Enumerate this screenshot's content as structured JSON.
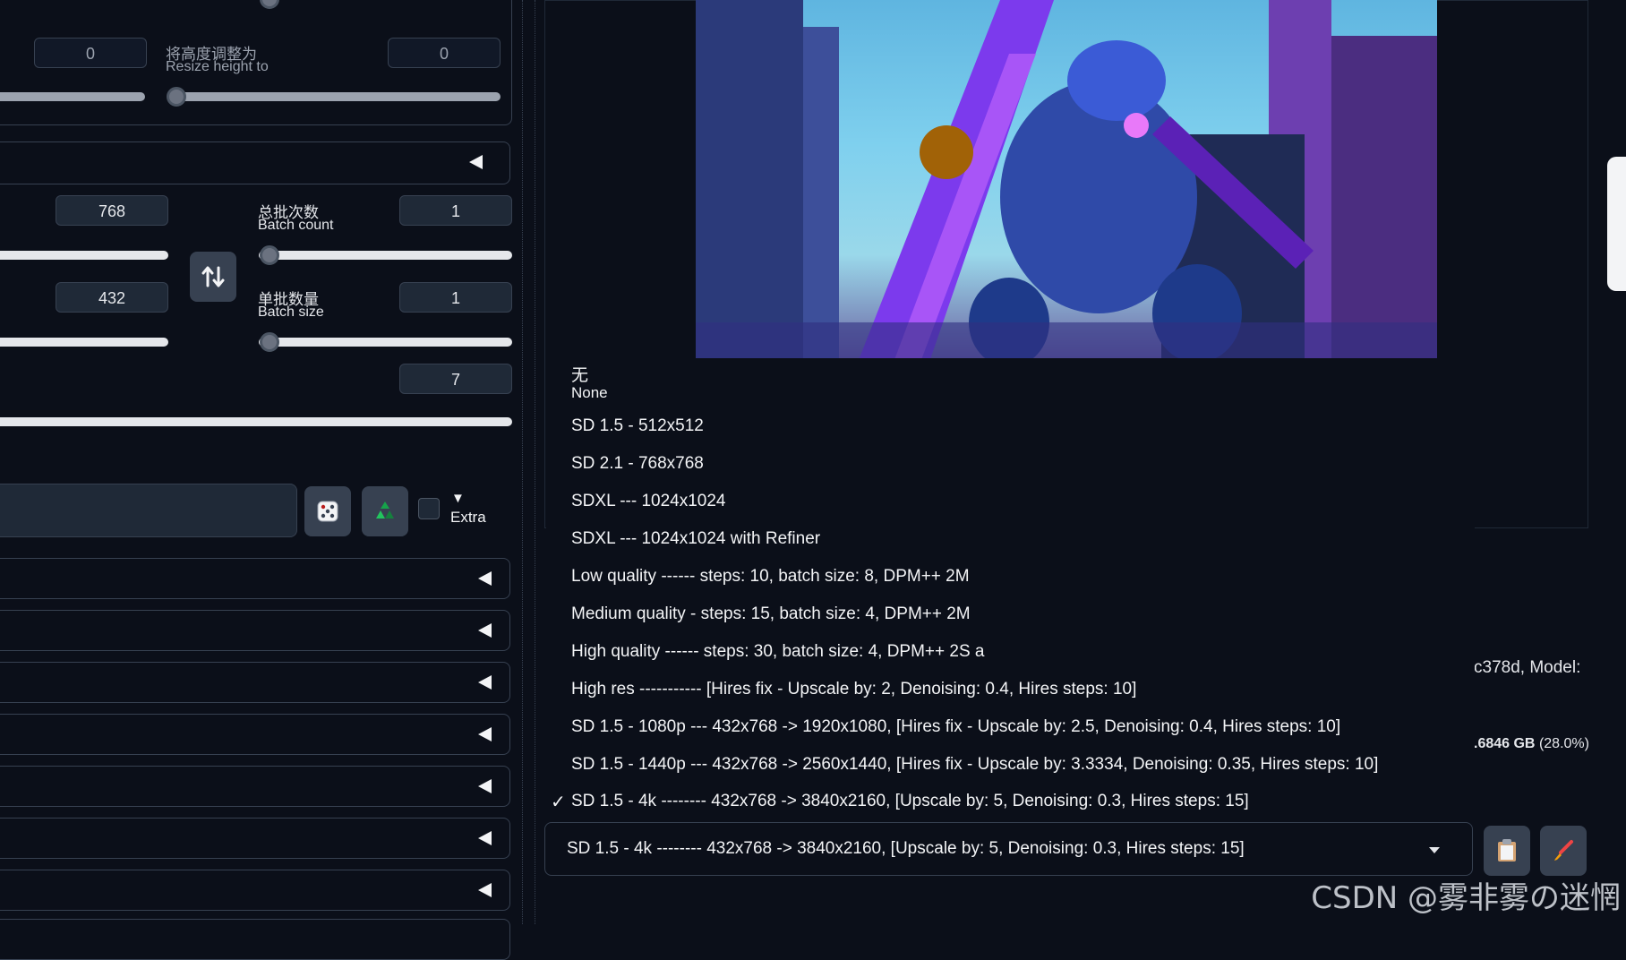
{
  "left_panel": {
    "resize_width_value": "0",
    "resize_height_cn": "将高度调整为",
    "resize_height_en": "Resize height to",
    "resize_height_value": "0",
    "width_value": "768",
    "height_value": "432",
    "batch_count_cn": "总批次数",
    "batch_count_en": "Batch count",
    "batch_count_value": "1",
    "batch_size_cn": "单批数量",
    "batch_size_en": "Batch size",
    "batch_size_value": "1",
    "cfg_value": "7",
    "swap_icon": "swap-vertical-arrows",
    "dice_icon": "dice",
    "recycle_icon": "recycle",
    "extra_label": "Extra",
    "extra_arrow": "▼",
    "accordion_count": 8
  },
  "styles_dropdown": {
    "options": [
      {
        "cn": "无",
        "en": "None"
      },
      {
        "label": "SD 1.5 - 512x512"
      },
      {
        "label": "SD 2.1 - 768x768"
      },
      {
        "label": "SDXL --- 1024x1024"
      },
      {
        "label": "SDXL --- 1024x1024 with Refiner"
      },
      {
        "label": "Low quality ------ steps: 10, batch size: 8, DPM++ 2M"
      },
      {
        "label": "Medium quality - steps: 15, batch size: 4, DPM++ 2M"
      },
      {
        "label": "High quality ------ steps: 30, batch size: 4, DPM++ 2S a"
      },
      {
        "label": "High res ----------- [Hires fix - Upscale by: 2, Denoising: 0.4, Hires steps: 10]"
      },
      {
        "label": "SD 1.5 - 1080p --- 432x768 -> 1920x1080, [Hires fix - Upscale by: 2.5, Denoising: 0.4, Hires steps: 10]"
      },
      {
        "label": "SD 1.5 - 1440p --- 432x768 -> 2560x1440, [Hires fix - Upscale by: 3.3334, Denoising: 0.35, Hires steps: 10]"
      },
      {
        "label": "SD 1.5 - 4k -------- 432x768 -> 3840x2160, [Upscale by: 5, Denoising: 0.3, Hires steps: 15]"
      }
    ],
    "check_mark": "✓",
    "selected_value": "SD 1.5 - 4k -------- 432x768 -> 3840x2160, [Upscale by: 5, Denoising: 0.3, Hires steps: 15]"
  },
  "output_info": {
    "model_fragment": "c378d, Model:",
    "vram_fragment": ".6846 GB",
    "vram_pct": "(28.0%)"
  },
  "buttons": {
    "paste_icon": "clipboard",
    "clear_icon": "paintbrush"
  },
  "watermark": "CSDN @雾非雾の迷惘",
  "colors": {
    "background": "#0b0f19",
    "input_bg": "#1f2937",
    "border": "#374151",
    "text": "#f3f4f6"
  }
}
